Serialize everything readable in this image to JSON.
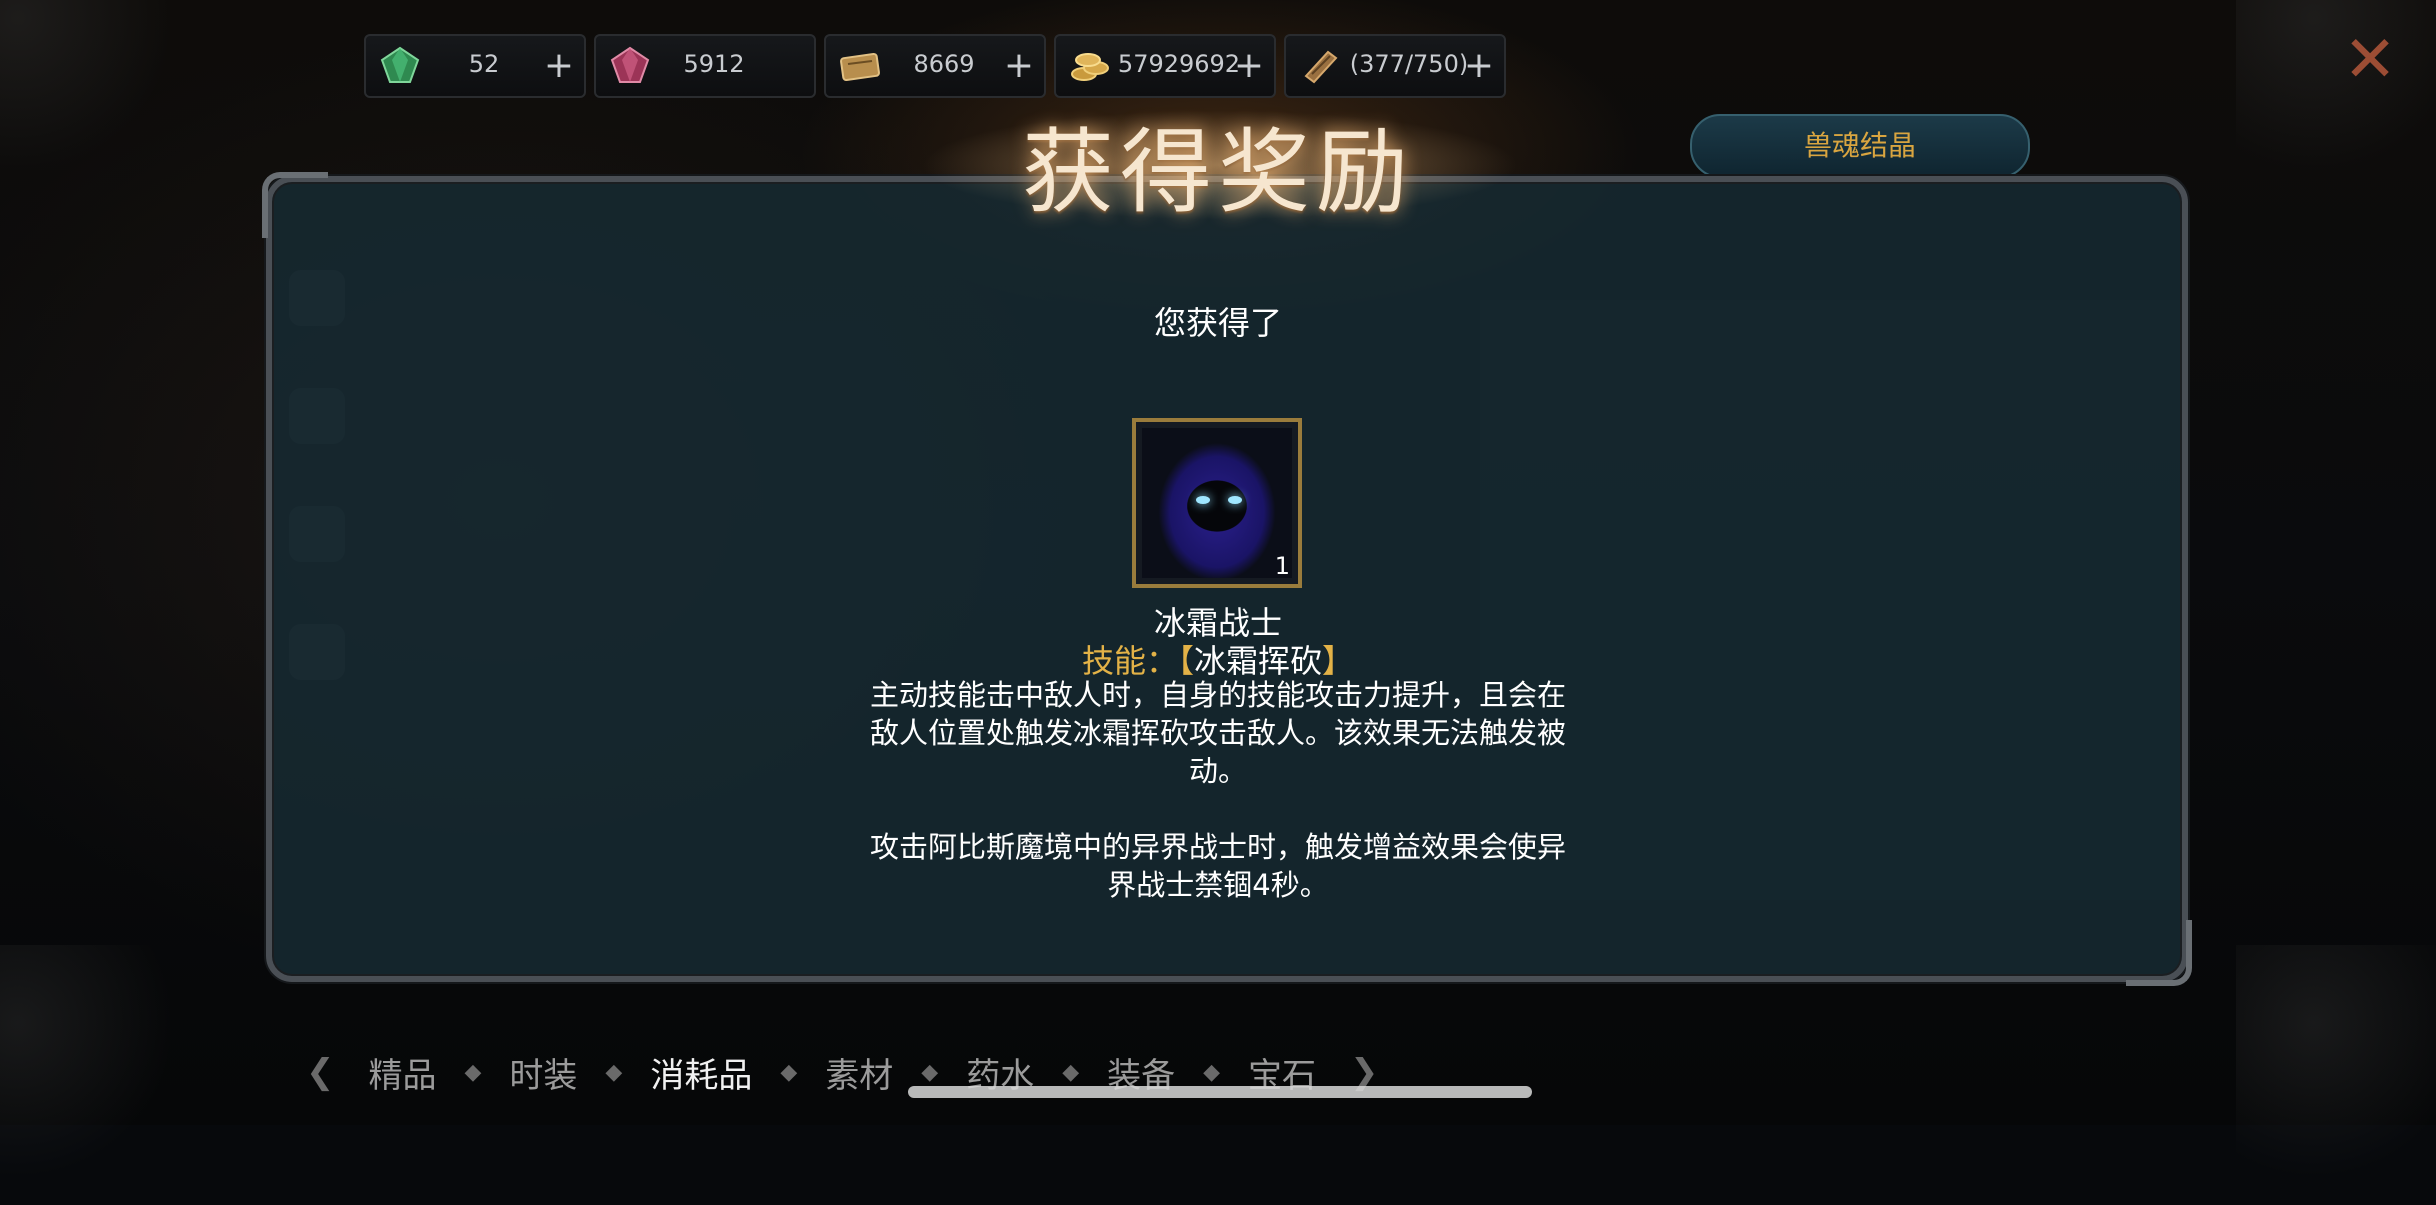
{
  "resources": [
    {
      "icon": "green-gem-icon",
      "value": "52",
      "has_plus": true,
      "color": "#3fa463"
    },
    {
      "icon": "red-crystal-icon",
      "value": "5912",
      "has_plus": false,
      "color": "#b04a6a"
    },
    {
      "icon": "ticket-scroll-icon",
      "value": "8669",
      "has_plus": true,
      "color": "#c7a460"
    },
    {
      "icon": "gold-coins-icon",
      "value": "57929692",
      "has_plus": true,
      "color": "#d1a54d"
    },
    {
      "icon": "stamina-scroll-icon",
      "value": "(377/750)",
      "has_plus": true,
      "color": "#a67d4a"
    }
  ],
  "top_right_tab": "兽魂结晶",
  "reward_dialog": {
    "title": "获得奖励",
    "subtitle": "您获得了",
    "item": {
      "name": "冰霜战士",
      "quantity": "1",
      "icon": "hooded-ice-warrior-icon"
    },
    "skill_label": "技能：",
    "skill_open": "【",
    "skill_name": "冰霜挥砍",
    "skill_close": "】",
    "description_1": "主动技能击中敌人时，自身的技能攻击力提升，且会在敌人位置处触发冰霜挥砍攻击敌人。该效果无法触发被动。",
    "description_2": "攻击阿比斯魔境中的异界战士时，触发增益效果会使异界战士禁锢4秒。"
  },
  "bottom_tabs": [
    {
      "label": "精品",
      "active": false
    },
    {
      "label": "时装",
      "active": false
    },
    {
      "label": "消耗品",
      "active": true
    },
    {
      "label": "素材",
      "active": false
    },
    {
      "label": "药水",
      "active": false
    },
    {
      "label": "装备",
      "active": false
    },
    {
      "label": "宝石",
      "active": false
    }
  ],
  "colors": {
    "accent_gold": "#e3b247",
    "title_glow": "#f6e6cf",
    "dialog_bg": "#162a32"
  }
}
